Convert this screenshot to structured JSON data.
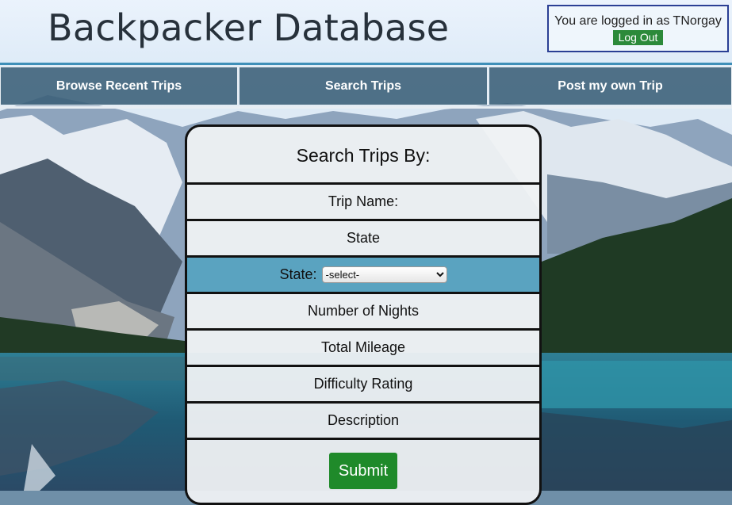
{
  "header": {
    "site_title": "Backpacker Database",
    "login_text": "You are logged in as TNorgay",
    "logout_label": "Log Out"
  },
  "nav": {
    "items": [
      {
        "label": "Browse Recent Trips"
      },
      {
        "label": "Search Trips"
      },
      {
        "label": "Post my own Trip"
      }
    ]
  },
  "search_panel": {
    "title": "Search Trips By:",
    "fields": [
      {
        "label": "Trip Name:"
      },
      {
        "label": "State"
      },
      {
        "label": "State:",
        "select_value": "-select-"
      },
      {
        "label": "Number of Nights"
      },
      {
        "label": "Total Mileage"
      },
      {
        "label": "Difficulty Rating"
      },
      {
        "label": "Description"
      }
    ],
    "submit_label": "Submit"
  },
  "colors": {
    "nav_bg": "#3a5f78",
    "active_field": "#5aa3c0",
    "logout_green": "#2c8a3a",
    "submit_green": "#1f8a2a",
    "login_border": "#2a3f94"
  },
  "icons": {
    "select_arrows": "updown-arrows-icon"
  }
}
